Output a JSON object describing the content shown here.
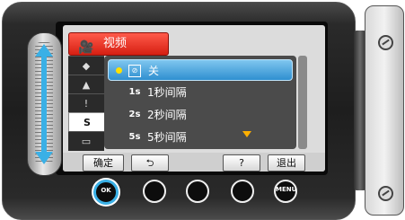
{
  "header": {
    "title": "视频",
    "icon": "video-camera-icon"
  },
  "side_tabs": [
    {
      "icon": "image-stabilizer-icon",
      "label": "◆"
    },
    {
      "icon": "scene-mountain-icon",
      "label": "▲"
    },
    {
      "icon": "exposure-icon",
      "label": "!"
    },
    {
      "icon": "time-lapse-icon",
      "label": "S"
    },
    {
      "icon": "monitor-icon",
      "label": "▭"
    }
  ],
  "menu_items": [
    {
      "icon_text": "OFF",
      "label": "关",
      "selected": true
    },
    {
      "icon_text": "1SEC",
      "label": "1秒间隔",
      "selected": false
    },
    {
      "icon_text": "2SEC",
      "label": "2秒间隔",
      "selected": false
    },
    {
      "icon_text": "5SEC",
      "label": "5秒间隔",
      "selected": false
    }
  ],
  "soft_buttons": {
    "confirm": "确定",
    "back": "⮌",
    "help": "?",
    "exit": "退出"
  },
  "hardware_buttons": {
    "ok": "OK",
    "menu": "MENU"
  },
  "colors": {
    "accent_blue": "#3ab0e6",
    "header_red": "#e0291a",
    "selection_blue": "#2f8fd0"
  }
}
